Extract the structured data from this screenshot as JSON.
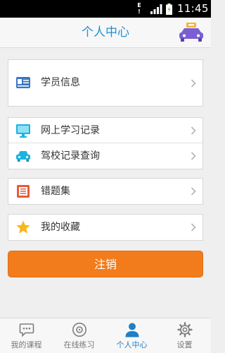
{
  "status_bar": {
    "time": "11:45",
    "alert_glyph": "E\n!"
  },
  "header": {
    "title": "个人中心",
    "action_icon": "car-icon"
  },
  "menu": {
    "groups": [
      {
        "items": [
          {
            "label": "学员信息",
            "icon": "id-card-icon"
          }
        ]
      },
      {
        "items": [
          {
            "label": "网上学习记录",
            "icon": "monitor-icon"
          },
          {
            "label": "驾校记录查询",
            "icon": "car-icon"
          }
        ]
      },
      {
        "items": [
          {
            "label": "错题集",
            "icon": "notebook-icon"
          }
        ]
      },
      {
        "items": [
          {
            "label": "我的收藏",
            "icon": "star-icon"
          }
        ]
      }
    ]
  },
  "logout_label": "注销",
  "tabs": [
    {
      "label": "我的课程",
      "icon": "chat-icon",
      "active": false
    },
    {
      "label": "在线练习",
      "icon": "disc-icon",
      "active": false
    },
    {
      "label": "个人中心",
      "icon": "person-icon",
      "active": true
    },
    {
      "label": "设置",
      "icon": "gear-icon",
      "active": false
    }
  ],
  "colors": {
    "accent": "#1f91d1",
    "logout": "#f27b1c",
    "active_tab": "#1f7fc8"
  }
}
